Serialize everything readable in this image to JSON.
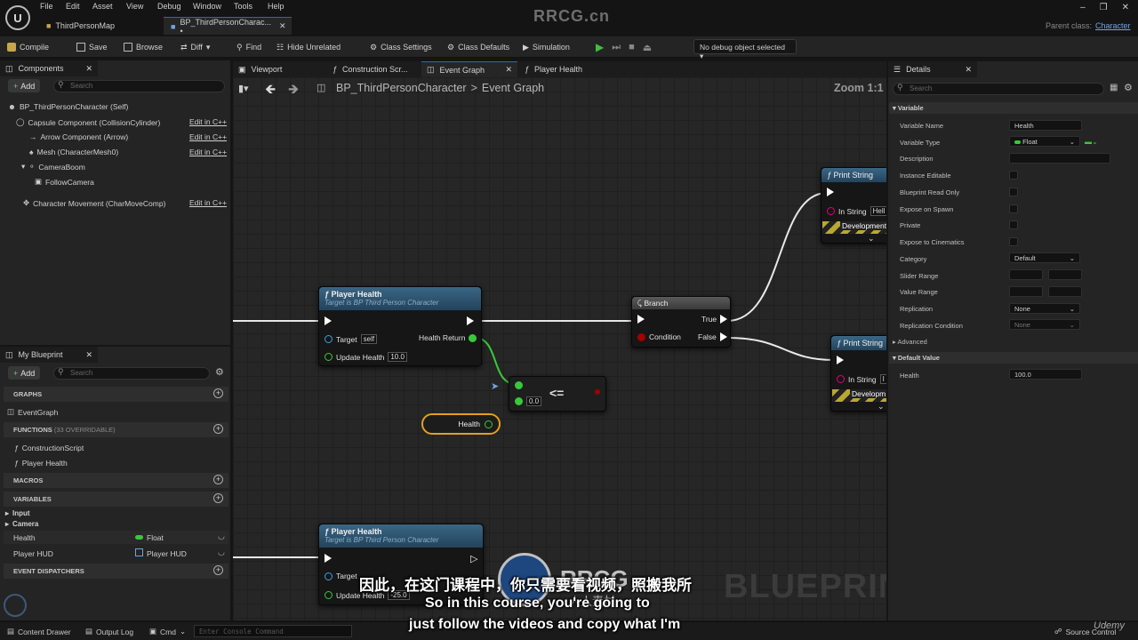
{
  "window": {
    "watermark": "RRCG.cn",
    "parent_class_label": "Parent class:",
    "parent_class_value": "Character",
    "menu": [
      "File",
      "Edit",
      "Asset",
      "View",
      "Debug",
      "Window",
      "Tools",
      "Help"
    ],
    "doc_tabs": [
      {
        "label": "ThirdPersonMap"
      },
      {
        "label": "BP_ThirdPersonCharac... •"
      }
    ]
  },
  "toolbar": {
    "compile": "Compile",
    "save": "Save",
    "browse": "Browse",
    "diff": "Diff",
    "find": "Find",
    "hide_unrelated": "Hide Unrelated",
    "class_settings": "Class Settings",
    "class_defaults": "Class Defaults",
    "simulation": "Simulation",
    "debug_object": "No debug object selected"
  },
  "components": {
    "tab": "Components",
    "add": "Add",
    "search_placeholder": "Search",
    "items": [
      {
        "label": "BP_ThirdPersonCharacter (Self)",
        "edit": ""
      },
      {
        "label": "Capsule Component (CollisionCylinder)",
        "edit": "Edit in C++"
      },
      {
        "label": "Arrow Component (Arrow)",
        "edit": "Edit in C++"
      },
      {
        "label": "Mesh (CharacterMesh0)",
        "edit": "Edit in C++"
      },
      {
        "label": "CameraBoom",
        "edit": ""
      },
      {
        "label": "FollowCamera",
        "edit": ""
      },
      {
        "label": "Character Movement (CharMoveComp)",
        "edit": "Edit in C++"
      }
    ]
  },
  "my_blueprint": {
    "tab": "My Blueprint",
    "add": "Add",
    "search_placeholder": "Search",
    "graphs_header": "GRAPHS",
    "event_graph": "EventGraph",
    "functions_header": "FUNCTIONS",
    "functions_count": "(33 OVERRIDABLE)",
    "functions": [
      "ConstructionScript",
      "Player Health"
    ],
    "macros_header": "MACROS",
    "variables_header": "VARIABLES",
    "categories": [
      "Input",
      "Camera"
    ],
    "variables": [
      {
        "name": "Health",
        "type": "Float"
      },
      {
        "name": "Player HUD",
        "type": "Player HUD"
      }
    ],
    "dispatchers_header": "EVENT DISPATCHERS"
  },
  "editor_tabs": [
    "Viewport",
    "Construction Scr...",
    "Event Graph",
    "Player Health"
  ],
  "graph": {
    "breadcrumb_bp": "BP_ThirdPersonCharacter",
    "breadcrumb_sep": ">",
    "breadcrumb_graph": "Event Graph",
    "zoom": "Zoom 1:1",
    "watermark": "BLUEPRINT",
    "node_player_health_1": {
      "title": "Player Health",
      "subtitle": "Target is BP Third Person Character",
      "target": "Target",
      "target_value": "self",
      "update_health": "Update Health",
      "update_value": "10.0",
      "health_return": "Health Return"
    },
    "node_branch": {
      "title": "Branch",
      "condition": "Condition",
      "true": "True",
      "false": "False"
    },
    "node_compare": {
      "op": "<=",
      "value": "0.0"
    },
    "node_health_get": {
      "label": "Health"
    },
    "node_print_1": {
      "title": "Print String",
      "in_string": "In String",
      "in_value": "Hell",
      "dev": "Development"
    },
    "node_print_2": {
      "title": "Print String",
      "in_string": "In String",
      "in_value": "I",
      "dev": "Developm"
    },
    "node_player_health_2": {
      "title": "Player Health",
      "subtitle": "Target is BP Third Person Character",
      "target": "Target",
      "update_health": "Update Health",
      "update_value": "-25.0"
    }
  },
  "details": {
    "tab": "Details",
    "search_placeholder": "Search",
    "variable_section": "Variable",
    "variable_name_label": "Variable Name",
    "variable_name_value": "Health",
    "variable_type_label": "Variable Type",
    "variable_type_value": "Float",
    "description_label": "Description",
    "instance_editable": "Instance Editable",
    "blueprint_read_only": "Blueprint Read Only",
    "expose_on_spawn": "Expose on Spawn",
    "private": "Private",
    "expose_to_cinematics": "Expose to Cinematics",
    "category_label": "Category",
    "category_value": "Default",
    "slider_range": "Slider Range",
    "value_range": "Value Range",
    "replication_label": "Replication",
    "replication_value": "None",
    "replication_condition_label": "Replication Condition",
    "replication_condition_value": "None",
    "advanced": "Advanced",
    "default_value_section": "Default Value",
    "health_label": "Health",
    "health_value": "100.0"
  },
  "statusbar": {
    "content_drawer": "Content Drawer",
    "output_log": "Output Log",
    "cmd": "Cmd",
    "console_placeholder": "Enter Console Command",
    "source_control": "Source Control"
  },
  "overlay": {
    "udemy": "Udemy",
    "logo_text": "RRCG",
    "logo_sub": "人人素材",
    "subtitle_cn": "因此，在这门课程中，你只需要看视频，照搬我所",
    "subtitle_en_1": "So in this course, you're going to",
    "subtitle_en_2": "just follow the videos and copy what I'm"
  },
  "colors": {
    "accent": "#0f6fd6",
    "float_pin": "#38c93a",
    "exec_pin": "#ffffff",
    "bool_pin": "#a30000",
    "string_pin": "#e0007a"
  }
}
